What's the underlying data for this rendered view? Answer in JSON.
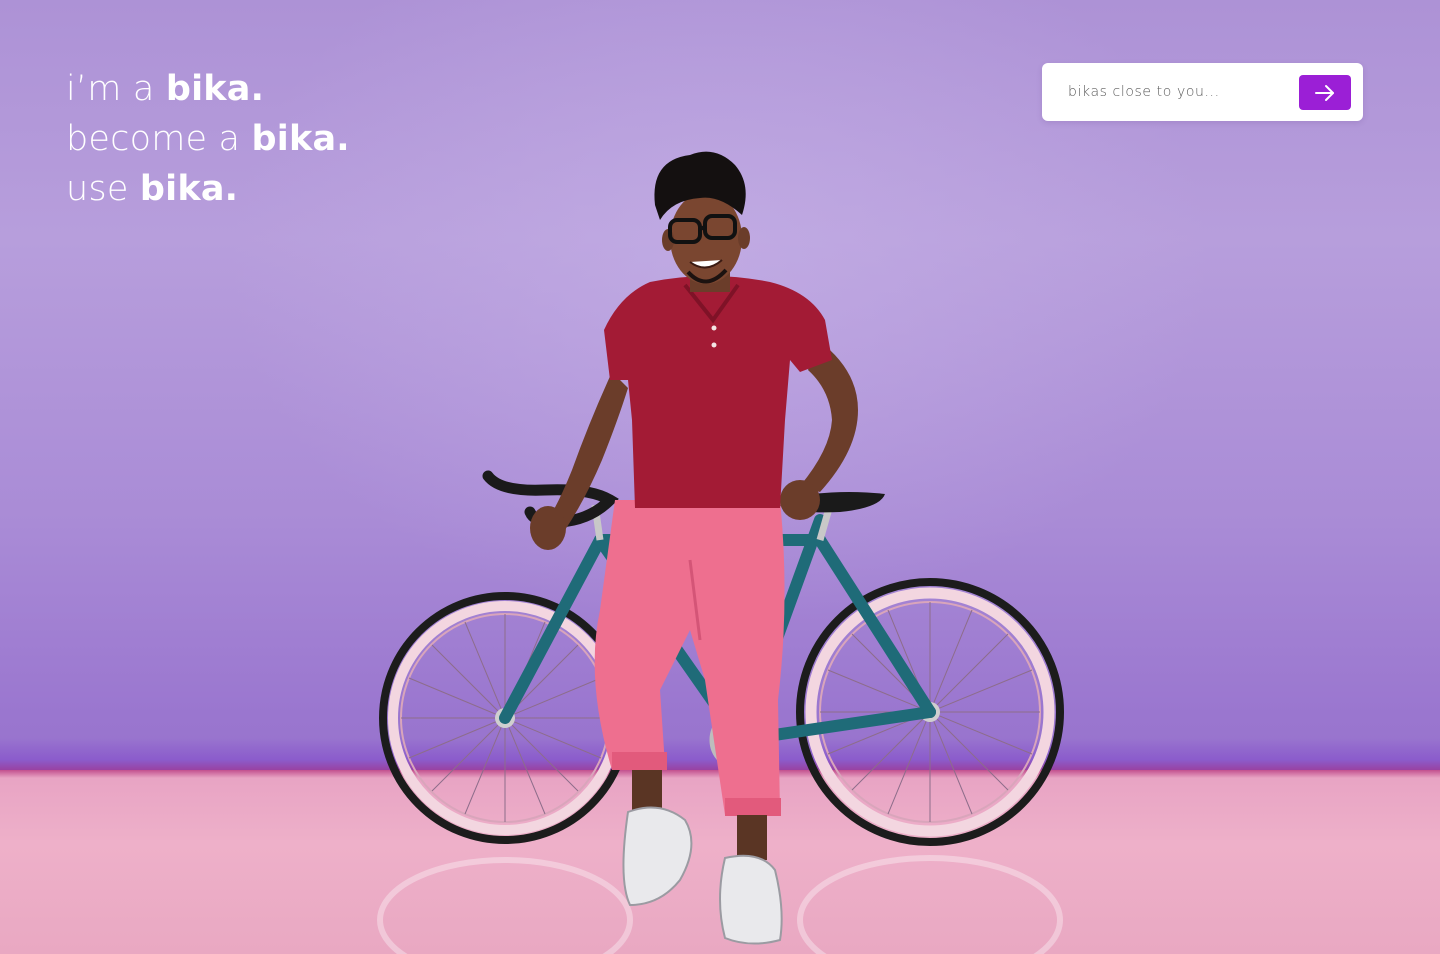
{
  "hero": {
    "tagline": [
      {
        "prefix": "i’m a ",
        "brand": "bika."
      },
      {
        "prefix": "become a ",
        "brand": "bika."
      },
      {
        "prefix": "use ",
        "brand": "bika."
      }
    ],
    "image_alt": "Smiling man in red polo shirt and pink trousers leaning on a teal bicycle against a purple wall"
  },
  "search": {
    "placeholder": "bikas close to you...",
    "submit_icon": "arrow-right-icon"
  },
  "colors": {
    "accent": "#9b1fd6",
    "wall": "#b39ada",
    "floor": "#eeb0c9",
    "text": "#ffffff"
  }
}
